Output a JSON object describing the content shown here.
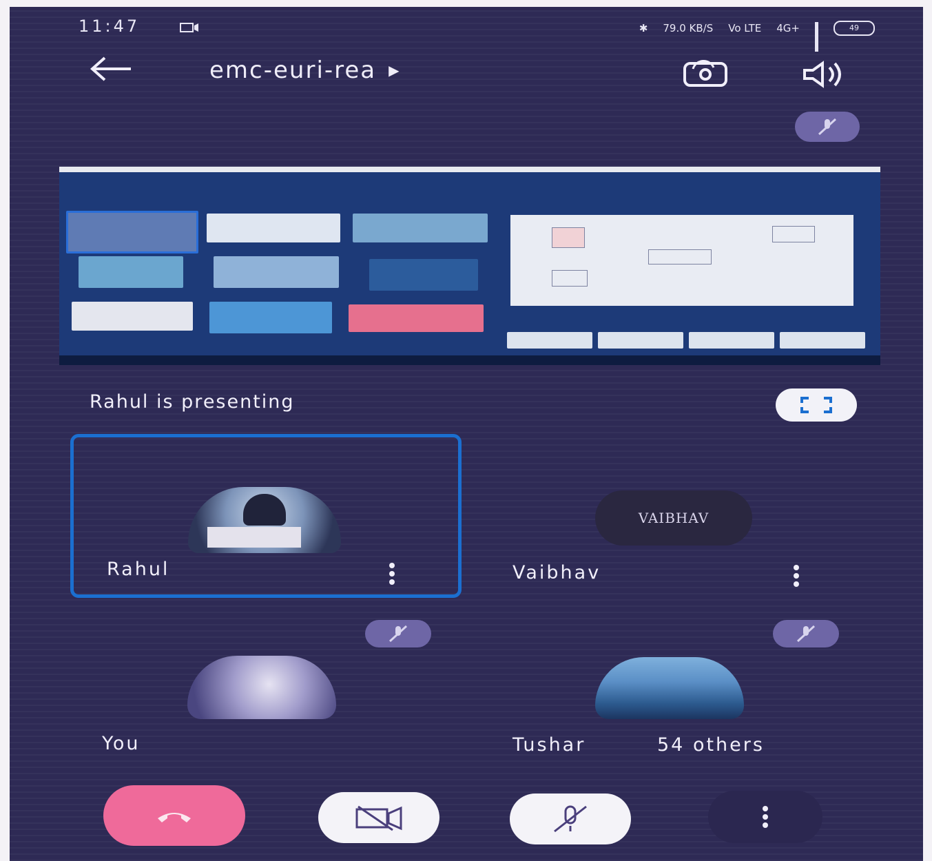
{
  "status_bar": {
    "time": "11:47",
    "net_speed": "79.0 KB/S",
    "net_type": "Vo LTE",
    "net_gen": "4G+",
    "battery": "49"
  },
  "header": {
    "meeting_code": "emc-euri-rea"
  },
  "presentation": {
    "status_text": "Rahul is presenting"
  },
  "participants": [
    {
      "name": "Rahul",
      "active": true
    },
    {
      "name": "Vaibhav",
      "avatar_text": "VAIBHAV"
    },
    {
      "name": "You",
      "muted": true
    },
    {
      "name": "Tushar",
      "muted": true
    }
  ],
  "others_label": "54 others",
  "colors": {
    "background": "#2e2a55",
    "active_border": "#1b6fd0",
    "end_call": "#ef6a9a",
    "chip": "#6e66a6"
  },
  "icons": [
    "back-arrow-icon",
    "play-triangle-icon",
    "switch-camera-icon",
    "speaker-icon",
    "mic-off-icon",
    "fullscreen-icon",
    "more-vert-icon",
    "end-call-icon",
    "camera-off-icon"
  ]
}
